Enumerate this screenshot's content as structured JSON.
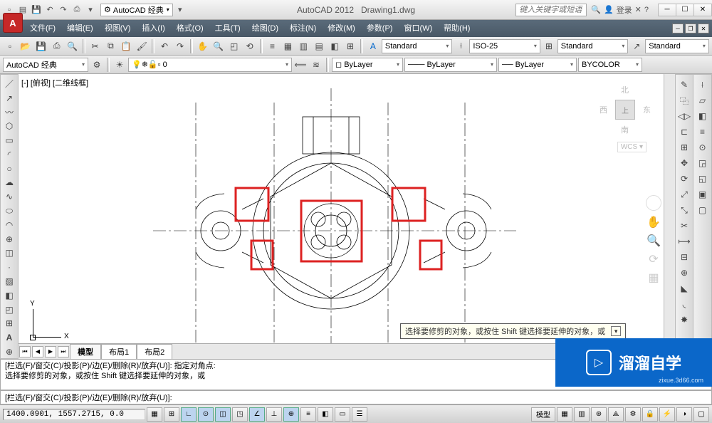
{
  "title": {
    "app": "AutoCAD 2012",
    "doc": "Drawing1.dwg"
  },
  "workspace_name": "AutoCAD 经典",
  "search_placeholder": "键入关键字或短语",
  "login_label": "登录",
  "menus": [
    "文件(F)",
    "编辑(E)",
    "视图(V)",
    "插入(I)",
    "格式(O)",
    "工具(T)",
    "绘图(D)",
    "标注(N)",
    "修改(M)",
    "参数(P)",
    "窗口(W)",
    "帮助(H)"
  ],
  "style_dropdowns": {
    "text": "Standard",
    "dim": "ISO-25",
    "table": "Standard",
    "mleader": "Standard"
  },
  "workspace_dropdown": "AutoCAD 经典",
  "layers": {
    "current": "0",
    "line": "ByLayer",
    "lw": "ByLayer",
    "color": "BYCOLOR",
    "bylayer": "ByLayer"
  },
  "view": {
    "label": "[-] [俯视] [二维线框]",
    "cube_face": "上",
    "n": "北",
    "s": "南",
    "e": "东",
    "w": "西",
    "wcs": "WCS ▾"
  },
  "ucs": {
    "x": "X",
    "y": "Y"
  },
  "tooltip": "选择要修剪的对象，或按住 Shift 键选择要延伸的对象，或",
  "tabs": {
    "model": "模型",
    "layout1": "布局1",
    "layout2": "布局2"
  },
  "command_history": [
    "[栏选(F)/窗交(C)/投影(P)/边(E)/删除(R)/放弃(U)]:  指定对角点:",
    "选择要修剪的对象，或按住 Shift 键选择要延伸的对象，或"
  ],
  "command_prompt": "[栏选(F)/窗交(C)/投影(P)/边(E)/删除(R)/放弃(U)]:",
  "status": {
    "coord": "1400.0901, 1557.2715, 0.0",
    "right": "模型"
  },
  "watermark": {
    "brand": "溜溜自学",
    "url": "zixue.3d66.com"
  }
}
